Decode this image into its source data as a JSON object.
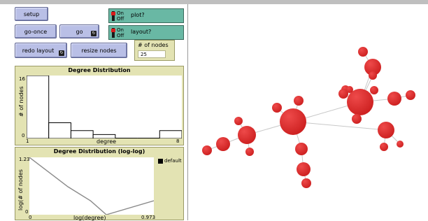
{
  "buttons": {
    "setup": "setup",
    "go_once": "go-once",
    "go": "go",
    "redo_layout": "redo layout",
    "resize_nodes": "resize nodes",
    "forever_glyph": "↻"
  },
  "switches": {
    "on": "On",
    "off": "Off",
    "plot": "plot?",
    "layout": "layout?"
  },
  "monitor": {
    "label": "# of nodes",
    "value": "25"
  },
  "plot1": {
    "title": "Degree Distribution",
    "ylabel": "# of nodes",
    "xlabel": "degree",
    "ymax": "16",
    "ymin": "0",
    "xmin": "1",
    "xmax": "8"
  },
  "plot2": {
    "title": "Degree Distribution (log-log)",
    "ylabel": "log(# of nodes",
    "xlabel": "log(degree)",
    "ymax": "1.23",
    "ymin": "0",
    "xmin": "0",
    "xmax": "0.973",
    "legend": "default"
  },
  "colors": {
    "button": "#b9bfe6",
    "switch": "#69b8a4",
    "monitor": "#e3e3b3",
    "node": "#cc1f1f",
    "edge": "#c8c8c8"
  },
  "chart_data": [
    {
      "type": "bar",
      "title": "Degree Distribution",
      "xlabel": "degree",
      "ylabel": "# of nodes",
      "categories": [
        1,
        2,
        3,
        4,
        5,
        6,
        7
      ],
      "values": [
        16,
        4,
        2,
        1,
        0,
        0,
        2
      ],
      "xlim": [
        1,
        8
      ],
      "ylim": [
        0,
        16
      ]
    },
    {
      "type": "line",
      "title": "Degree Distribution (log-log)",
      "xlabel": "log(degree)",
      "ylabel": "log(# of nodes",
      "series": [
        {
          "name": "default",
          "x": [
            0,
            0.301,
            0.477,
            0.602,
            0.973
          ],
          "y": [
            1.23,
            0.6,
            0.3,
            0.0,
            0.3
          ]
        }
      ],
      "xlim": [
        0,
        0.973
      ],
      "ylim": [
        0,
        1.23
      ]
    }
  ]
}
